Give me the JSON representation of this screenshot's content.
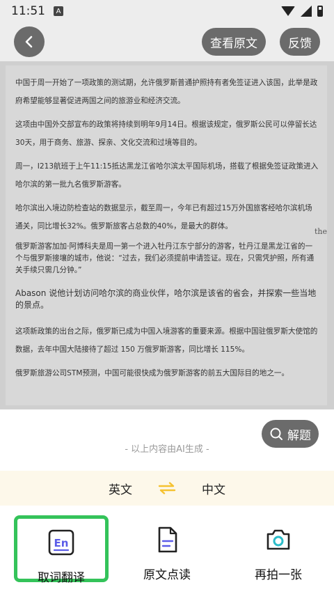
{
  "status_bar": {
    "time": "11:51",
    "notification_badge": "A"
  },
  "header": {
    "view_original_label": "查看原文",
    "feedback_label": "反馈"
  },
  "document": {
    "paragraphs": [
      "中国于周一开始了一项政策的测试期，允许俄罗斯普通护照持有者免签证进入该国，此举是政府希望能够显著促进两国之间的旅游业和经济交流。",
      "这项由中国外交部宣布的政策将持续到明年9月14日。根据该规定，俄罗斯公民可以停留长达30天，用于商务、旅游、探亲、文化交流和过境等目的。",
      "周一，I213航班于上午11:15抵达黑龙江省哈尔滨太平国际机场，搭载了根据免签证政策进入哈尔滨的第一批九名俄罗斯游客。",
      "哈尔滨出入境边防检查站的数据显示，截至周一，今年已有超过15万外国旅客经哈尔滨机场通关，同比增长32%。俄罗斯旅客占总数的40%，是最大的群体。",
      "俄罗斯游客加加·阿博科夫是周一第一个进入牡丹江东宁部分的游客，牡丹江是黑龙江省的一个与俄罗斯接壤的城市，他说：“过去，我们必须提前申请签证。现在，只需凭护照，所有通关手续只需几分钟。”",
      "Abason 说他计划访问哈尔滨的商业伙伴，哈尔滨是该省的省会，并探索一些当地的景点。",
      "这项新政策的出台之际，俄罗斯已成为中国入境游客的重要来源。根据中国驻俄罗斯大使馆的数据，去年中国大陆接待了超过 150 万俄罗斯游客，同比增长 115%。",
      "俄罗斯旅游公司STM预测，中国可能很快成为俄罗斯游客的前五大国际目的地之一。"
    ],
    "stray_text": "the"
  },
  "solve_button_label": "解题",
  "ai_note": "- 以上内容由AI生成 -",
  "language": {
    "source": "英文",
    "target": "中文"
  },
  "tools": [
    {
      "label": "取词翻译",
      "icon_text": "En"
    },
    {
      "label": "原文点读"
    },
    {
      "label": "再拍一张"
    }
  ],
  "colors": {
    "highlight_green": "#34c35a",
    "swap_yellow": "#f5c230",
    "accent_blue": "#5b5ce8",
    "camera_teal": "#2bbcc9"
  }
}
